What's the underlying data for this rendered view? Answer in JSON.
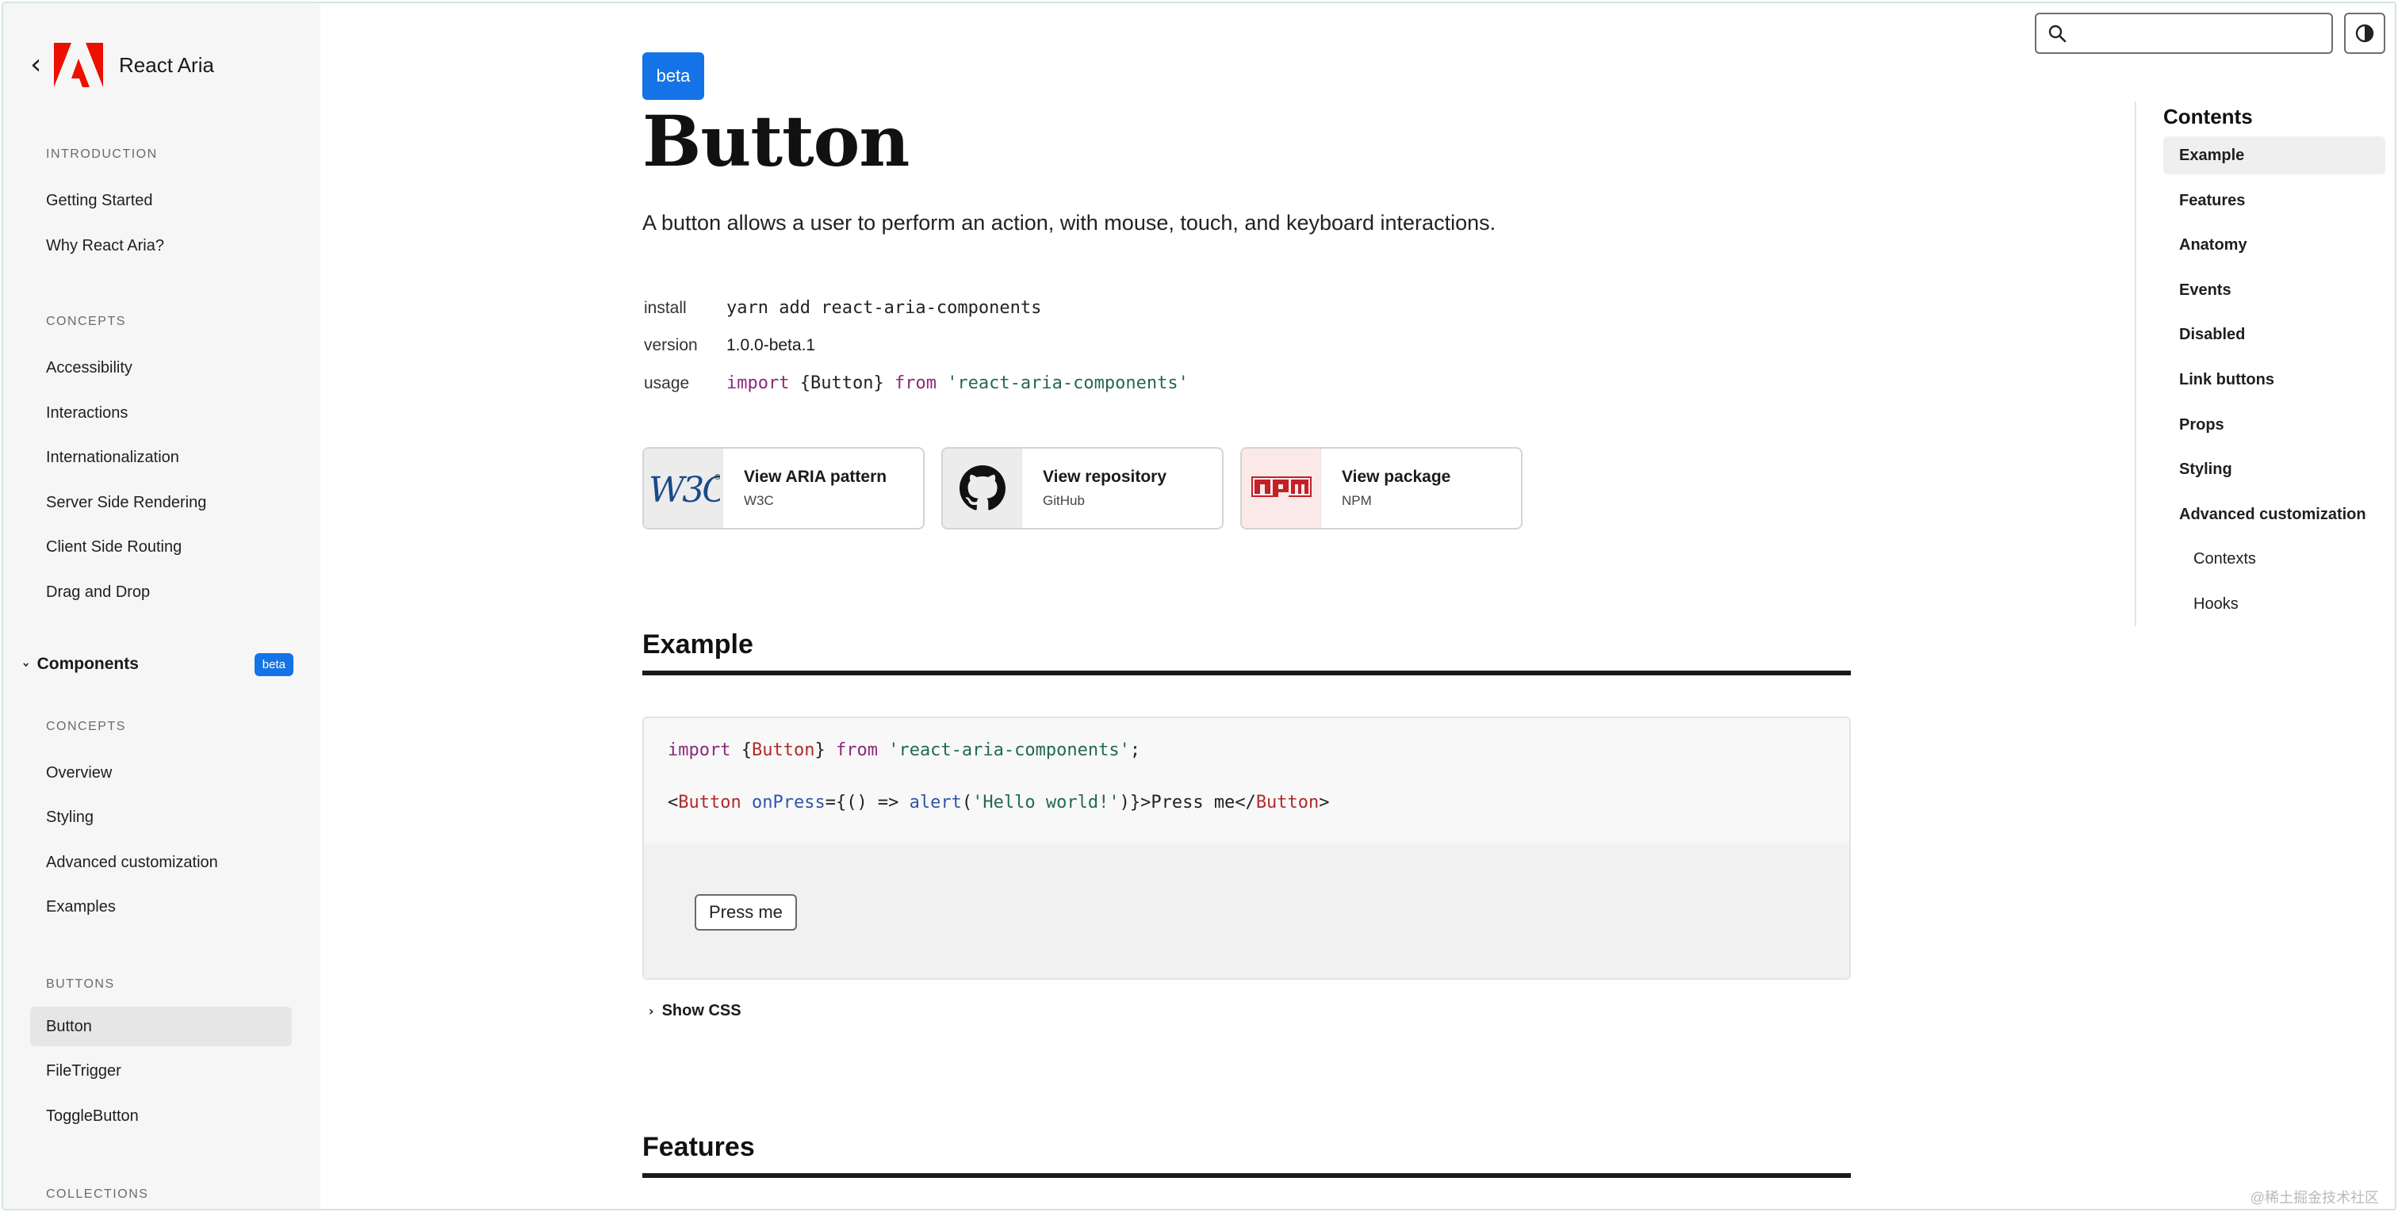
{
  "sidebar": {
    "brand": "React Aria",
    "sections": [
      {
        "title": "INTRODUCTION",
        "items": [
          "Getting Started",
          "Why React Aria?"
        ]
      },
      {
        "title": "CONCEPTS",
        "items": [
          "Accessibility",
          "Interactions",
          "Internationalization",
          "Server Side Rendering",
          "Client Side Routing",
          "Drag and Drop"
        ]
      }
    ],
    "components_group": {
      "label": "Components",
      "badge": "beta"
    },
    "components_sections": [
      {
        "title": "CONCEPTS",
        "items": [
          "Overview",
          "Styling",
          "Advanced customization",
          "Examples"
        ]
      },
      {
        "title": "BUTTONS",
        "items": [
          "Button",
          "FileTrigger",
          "ToggleButton"
        ]
      },
      {
        "title": "COLLECTIONS",
        "items": []
      }
    ],
    "active_item": "Button"
  },
  "header": {
    "search_placeholder": "",
    "theme_toggle_icon": "contrast-icon"
  },
  "main": {
    "badge": "beta",
    "title": "Button",
    "lead": "A button allows a user to perform an action, with mouse, touch, and keyboard interactions.",
    "meta": {
      "install_label": "install",
      "install_value": "yarn add react-aria-components",
      "version_label": "version",
      "version_value": "1.0.0-beta.1",
      "usage_label": "usage",
      "usage_import": "import",
      "usage_names": "{Button}",
      "usage_from": "from",
      "usage_module": "'react-aria-components'"
    },
    "links": [
      {
        "title": "View ARIA pattern",
        "subtitle": "W3C",
        "icon": "w3c-logo-icon",
        "thumb_color": "#ececec"
      },
      {
        "title": "View repository",
        "subtitle": "GitHub",
        "icon": "github-icon",
        "thumb_color": "#ececec"
      },
      {
        "title": "View package",
        "subtitle": "NPM",
        "icon": "npm-icon",
        "thumb_color": "#fbe9ea"
      }
    ],
    "example": {
      "heading": "Example",
      "code": {
        "import_kw": "import",
        "import_names_open": " {",
        "import_name": "Button",
        "import_names_close": "} ",
        "from_kw": "from",
        "module": "'react-aria-components'",
        "semicolon": ";",
        "lt": "<",
        "tag": "Button",
        "attr": "onPress",
        "eq_open": "={() => ",
        "fn": "alert",
        "paren_open": "(",
        "arg": "'Hello world!'",
        "paren_close": ")}>",
        "children": "Press me",
        "close_lt": "</",
        "close_tag": "Button",
        "gt": ">"
      },
      "preview_button": "Press me",
      "show_css": "Show CSS"
    },
    "features_heading": "Features"
  },
  "toc": {
    "title": "Contents",
    "items": [
      {
        "label": "Example",
        "active": true,
        "sub": false
      },
      {
        "label": "Features",
        "active": false,
        "sub": false
      },
      {
        "label": "Anatomy",
        "active": false,
        "sub": false
      },
      {
        "label": "Events",
        "active": false,
        "sub": false
      },
      {
        "label": "Disabled",
        "active": false,
        "sub": false
      },
      {
        "label": "Link buttons",
        "active": false,
        "sub": false
      },
      {
        "label": "Props",
        "active": false,
        "sub": false
      },
      {
        "label": "Styling",
        "active": false,
        "sub": false
      },
      {
        "label": "Advanced customization",
        "active": false,
        "sub": false
      },
      {
        "label": "Contexts",
        "active": false,
        "sub": true
      },
      {
        "label": "Hooks",
        "active": false,
        "sub": true
      }
    ]
  },
  "watermark": "@稀土掘金技术社区",
  "colors": {
    "accent": "#1473e6",
    "sidebar_bg": "#f6f6f6",
    "adobe_red": "#eb1000"
  }
}
